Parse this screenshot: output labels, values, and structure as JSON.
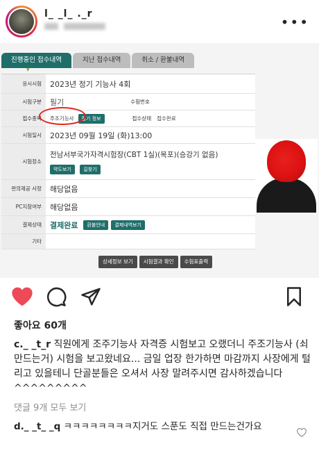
{
  "header": {
    "username": "l_ _l_ ._r",
    "subline": "",
    "more_icon": "more-horizontal-icon"
  },
  "screenshot": {
    "tabs": [
      "진행중인 접수내역",
      "지난 접수내역",
      "취소 / 환불내역"
    ],
    "rows": {
      "exam_round_label": "응시시험",
      "exam_round_value": "2023년 정기 기능사 4회",
      "exam_type_label": "시험구분",
      "exam_type_value": "필기",
      "exam_number_label": "수험번호",
      "exam_number_value": "",
      "subject_label": "접수종목",
      "subject_value": "주조기능사",
      "subject_button": "필기 정보",
      "status_label": "접수상태",
      "status_value": "접수완료",
      "exam_date_label": "시험일시",
      "exam_date_value": "2023년 09월 19일 (화)13:00",
      "location_label": "시험장소",
      "location_value": "전남서부국가자격시험장(CBT 1실)(목포)(승강기 없음)",
      "location_btn_map": "약도보기",
      "location_btn_directions": "길찾기",
      "accommodation_label": "편의제공 사항",
      "accommodation_value": "해당없음",
      "pc_label": "PC지참여부",
      "pc_value": "해당없음",
      "payment_label": "결제상태",
      "payment_value": "결제완료",
      "payment_btn_refund": "환불안내",
      "payment_btn_history": "결제내역보기",
      "etc_label": "기타"
    },
    "buttons": [
      "상세정보 보기",
      "시험결과 확인",
      "수험표출력"
    ]
  },
  "actions": {
    "like_icon": "heart-filled-icon",
    "comment_icon": "comment-icon",
    "share_icon": "send-icon",
    "save_icon": "bookmark-icon",
    "like_color": "#ed4956"
  },
  "likes": "좋아요 60개",
  "caption": {
    "user": "c._ _t_r",
    "text": " 직원에게 조주기능사 자격증 시험보고 오랬더니 주조기능사 (쇠만드는거) 시험을 보고왔네요... 금일 업장 한가하면 마감까지 사장에게 털리고 있을테니 단골분들은 오셔서 사장 말려주시면 감사하겠습니다 ^^^^^^^^^"
  },
  "view_comments": "댓글 9개 모두 보기",
  "comment": {
    "user": "d._ _t_ _q",
    "text": " ㅋㅋㅋㅋㅋㅋㅋㅋ지거도 스푼도 직접 만드는건가요"
  }
}
